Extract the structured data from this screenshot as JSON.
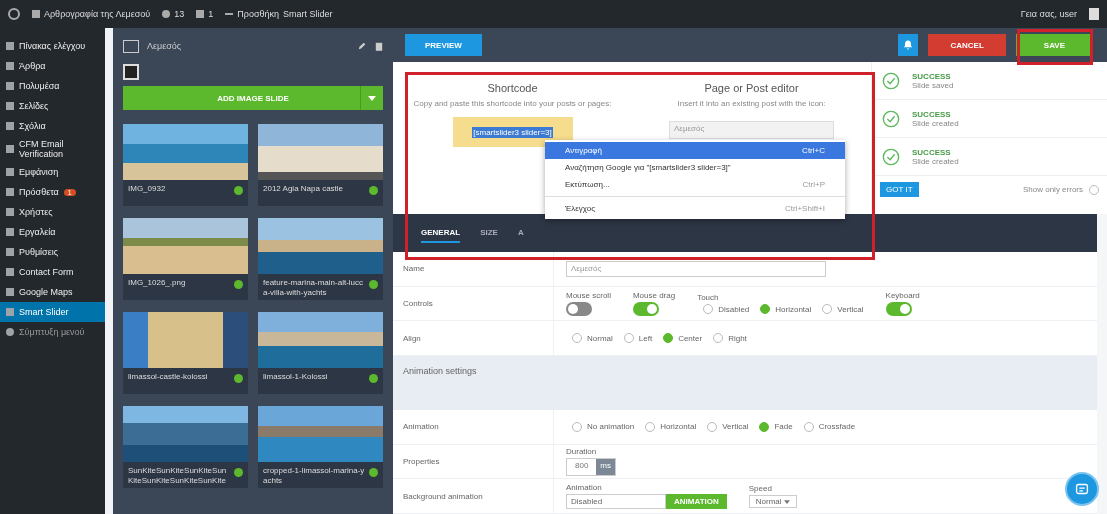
{
  "admin_bar": {
    "site": "Αρθρογραφία της Λεμεσού",
    "updates": "13",
    "comments": "1",
    "new": "Προσθήκη",
    "plugin": "Smart Slider",
    "greeting": "Γεια σας, user"
  },
  "sidebar": {
    "items": [
      {
        "label": "Πίνακας ελέγχου",
        "selected": false
      },
      {
        "label": "Άρθρα",
        "selected": false
      },
      {
        "label": "Πολυμέσα",
        "selected": false
      },
      {
        "label": "Σελίδες",
        "selected": false
      },
      {
        "label": "Σχόλια",
        "selected": false
      },
      {
        "label": "CFM Email Verification",
        "selected": false
      },
      {
        "label": "Εμφάνιση",
        "selected": false
      },
      {
        "label": "Πρόσθετα",
        "selected": false,
        "badge": "1"
      },
      {
        "label": "Χρήστες",
        "selected": false
      },
      {
        "label": "Εργαλεία",
        "selected": false
      },
      {
        "label": "Ρυθμίσεις",
        "selected": false
      },
      {
        "label": "Contact Form",
        "selected": false
      },
      {
        "label": "Google Maps",
        "selected": false
      },
      {
        "label": "Smart Slider",
        "selected": true
      }
    ],
    "collapse": "Σύμπτυξη μενού"
  },
  "slides_panel": {
    "slider_name": "Λεμεσός",
    "add_button": "ADD IMAGE SLIDE",
    "slides": [
      {
        "title": "IMG_0932",
        "published": true
      },
      {
        "title": "2012 Agia Napa castle",
        "published": true
      },
      {
        "title": "IMG_1026_.png",
        "published": true
      },
      {
        "title": "feature-marina-main-alt-lucca-villa-with-yachts",
        "published": true
      },
      {
        "title": "limassol-castle-kolossi",
        "published": true
      },
      {
        "title": "limassol-1-Kolossi",
        "published": true
      },
      {
        "title": "SunKiteSunKiteSunKiteSunKiteSunKiteSunKiteSunKite",
        "published": true
      },
      {
        "title": "cropped-1-limassol-marina-yachts",
        "published": true
      }
    ]
  },
  "toolbar": {
    "preview": "PREVIEW",
    "cancel": "CANCEL",
    "save": "SAVE"
  },
  "publish": {
    "shortcode_title": "Shortcode",
    "shortcode_hint": "Copy and paste this shortcode into your posts or pages:",
    "shortcode": "[smartslider3 slider=3]",
    "editor_title": "Page or Post editor",
    "editor_hint": "Insert it into an existing post with the icon:",
    "editor_value": "Λεμεσός"
  },
  "context_menu": [
    {
      "label": "Αντιγραφή",
      "shortcut": "Ctrl+C",
      "selected": true
    },
    {
      "label": "Αναζήτηση Google για \"[smartslider3 slider=3]\"",
      "selected": false
    },
    {
      "label": "Εκτύπωση...",
      "shortcut": "Ctrl+P",
      "selected": false
    },
    {
      "label": "Έλεγχος",
      "shortcut": "Ctrl+Shift+I",
      "selected": false
    }
  ],
  "notifications": [
    {
      "title": "SUCCESS",
      "text": "Slide saved"
    },
    {
      "title": "SUCCESS",
      "text": "Slide created"
    },
    {
      "title": "SUCCESS",
      "text": "Slide created"
    }
  ],
  "got_it": "GOT IT",
  "show_only_errors": {
    "label": "Show only errors",
    "checked": false
  },
  "tabs": [
    {
      "label": "GENERAL",
      "selected": true
    },
    {
      "label": "SIZE",
      "selected": false
    },
    {
      "label": "A",
      "selected": false
    }
  ],
  "form": {
    "name_label": "Name",
    "name_value": "Λεμεσός",
    "controls_label": "Controls",
    "controls": [
      {
        "kind": "toggle",
        "label": "Mouse scroll",
        "on": false
      },
      {
        "kind": "toggle",
        "label": "Mouse drag",
        "on": true
      },
      {
        "kind": "radios",
        "label": "Touch",
        "options": [
          {
            "label": "Disabled",
            "selected": false
          },
          {
            "label": "Horizontal",
            "selected": true
          },
          {
            "label": "Vertical",
            "selected": false
          }
        ]
      },
      {
        "kind": "toggle",
        "label": "Keyboard",
        "on": true
      }
    ],
    "align_label": "Align",
    "align": [
      {
        "label": "Normal",
        "selected": false
      },
      {
        "label": "Left",
        "selected": false
      },
      {
        "label": "Center",
        "selected": true
      },
      {
        "label": "Right",
        "selected": false
      }
    ],
    "section": "Animation settings",
    "animation_label": "Animation",
    "animation": [
      {
        "label": "No animation",
        "selected": false
      },
      {
        "label": "Horizontal",
        "selected": false
      },
      {
        "label": "Vertical",
        "selected": false
      },
      {
        "label": "Fade",
        "selected": true
      },
      {
        "label": "Crossfade",
        "selected": false
      }
    ],
    "properties_label": "Properties",
    "duration_label": "Duration",
    "duration": "800",
    "duration_unit": "ms",
    "bg_label": "Background animation",
    "bg_anim_label": "Animation",
    "bg_anim_value": "Disabled",
    "bg_anim_button": "ANIMATION",
    "speed_label": "Speed",
    "speed_value": "Normal"
  }
}
